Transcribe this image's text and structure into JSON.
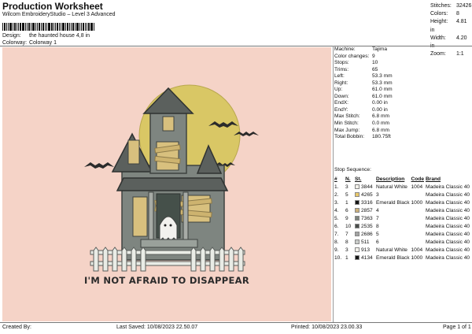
{
  "header": {
    "title": "Production Worksheet",
    "subtitle": "Wilcom EmbroideryStudio – Level 3 Advanced",
    "design_label": "Design:",
    "design_value": "the haunted house 4,8 in",
    "colorway_label": "Colorway:",
    "colorway_value": "Colorway 1"
  },
  "stats": [
    {
      "label": "Stitches:",
      "value": "32426"
    },
    {
      "label": "Colors:",
      "value": "8"
    },
    {
      "label": "Height:",
      "value": "4.81 in"
    },
    {
      "label": "Width:",
      "value": "4.20 in"
    },
    {
      "label": "Zoom:",
      "value": "1:1"
    }
  ],
  "info": [
    {
      "label": "Machine:",
      "value": "Tajima"
    },
    {
      "label": "Color changes:",
      "value": "9"
    },
    {
      "label": "Stops:",
      "value": "10"
    },
    {
      "label": "Trims:",
      "value": "65"
    },
    {
      "label": "Left:",
      "value": "53.3 mm"
    },
    {
      "label": "Right:",
      "value": "53.3 mm"
    },
    {
      "label": "Up:",
      "value": "61.0 mm"
    },
    {
      "label": "Down:",
      "value": "61.0 mm"
    },
    {
      "label": "EndX:",
      "value": "0.00 in"
    },
    {
      "label": "EndY:",
      "value": "0.00 in"
    },
    {
      "label": "Max Stitch:",
      "value": "6.8 mm"
    },
    {
      "label": "Min Stitch:",
      "value": "0.0 mm"
    },
    {
      "label": "Max Jump:",
      "value": "6.8 mm"
    },
    {
      "label": "Total Bobbin:",
      "value": "180.75ft"
    }
  ],
  "stop_sequence": {
    "title": "Stop Sequence:",
    "headers": [
      "#",
      "N.",
      "St.",
      "Description",
      "Code",
      "Brand"
    ],
    "rows": [
      {
        "num": "1.",
        "n": "3",
        "st": "3844",
        "desc": "Natural White",
        "code": "1004",
        "brand": "Madeira Classic 40",
        "color": "#f3f1ea"
      },
      {
        "num": "2.",
        "n": "5",
        "st": "4265",
        "desc": "3",
        "code": "",
        "brand": "Madeira Classic 40",
        "color": "#e8c86a"
      },
      {
        "num": "3.",
        "n": "1",
        "st": "3316",
        "desc": "Emerald Black",
        "code": "1000",
        "brand": "Madeira Classic 40",
        "color": "#151515"
      },
      {
        "num": "4.",
        "n": "6",
        "st": "2857",
        "desc": "4",
        "code": "",
        "brand": "Madeira Classic 40",
        "color": "#cbb07a"
      },
      {
        "num": "5.",
        "n": "9",
        "st": "7363",
        "desc": "7",
        "code": "",
        "brand": "Madeira Classic 40",
        "color": "#7d847e"
      },
      {
        "num": "6.",
        "n": "10",
        "st": "2535",
        "desc": "8",
        "code": "",
        "brand": "Madeira Classic 40",
        "color": "#4a4d4b"
      },
      {
        "num": "7.",
        "n": "7",
        "st": "2686",
        "desc": "5",
        "code": "",
        "brand": "Madeira Classic 40",
        "color": "#a2a3a2"
      },
      {
        "num": "8.",
        "n": "8",
        "st": "511",
        "desc": "6",
        "code": "",
        "brand": "Madeira Classic 40",
        "color": "#c9ccc9"
      },
      {
        "num": "9.",
        "n": "3",
        "st": "913",
        "desc": "Natural White",
        "code": "1004",
        "brand": "Madeira Classic 40",
        "color": "#f3f1ea"
      },
      {
        "num": "10.",
        "n": "1",
        "st": "4134",
        "desc": "Emerald Black",
        "code": "1000",
        "brand": "Madeira Classic 40",
        "color": "#151515"
      }
    ]
  },
  "design_text": "I'M NOT AFRAID TO DISAPPEAR",
  "footer": {
    "created": "Created By:",
    "saved": "Last Saved: 10/08/2023 22.50.07",
    "printed": "Printed: 10/08/2023 23.00.33",
    "page": "Page 1 of 1"
  },
  "colors": {
    "background": "#f5d3c7",
    "moon": "#d9c765",
    "house": "#7e8580",
    "roof": "#5b605d",
    "boards": "#d8c07e",
    "fence": "#e9ece6"
  }
}
